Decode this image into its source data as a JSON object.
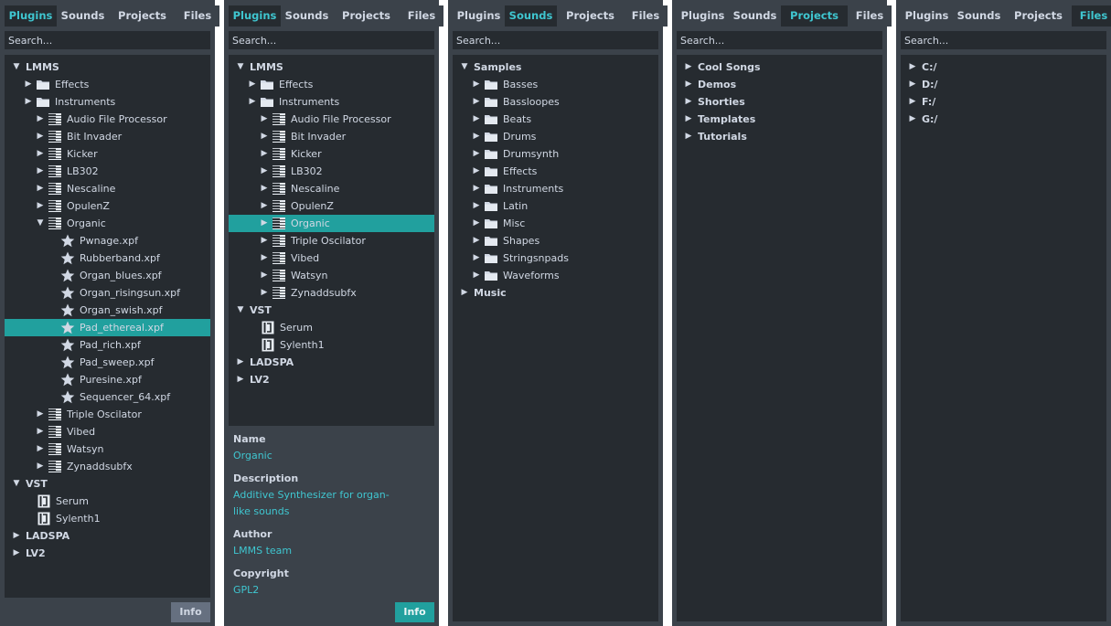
{
  "colors": {
    "panel_bg": "#3b424a",
    "tree_bg": "#262b30",
    "accent": "#3fc6d0",
    "selection": "#21a09e",
    "text": "#d1d8e4"
  },
  "tabs": [
    "Plugins",
    "Sounds",
    "Projects",
    "Files"
  ],
  "search_placeholder": "Search...",
  "info_label": "Info",
  "panels": [
    {
      "active_tab": "Plugins",
      "tree": [
        {
          "label": "LMMS",
          "level": 0,
          "arrow": "down",
          "icon": "none",
          "bold": true
        },
        {
          "label": "Effects",
          "level": 1,
          "arrow": "right",
          "icon": "folder-icon"
        },
        {
          "label": "Instruments",
          "level": 1,
          "arrow": "right",
          "icon": "folder-icon"
        },
        {
          "label": "Audio File Processor",
          "level": 2,
          "arrow": "right",
          "icon": "piano-icon"
        },
        {
          "label": "Bit Invader",
          "level": 2,
          "arrow": "right",
          "icon": "piano-icon"
        },
        {
          "label": "Kicker",
          "level": 2,
          "arrow": "right",
          "icon": "piano-icon"
        },
        {
          "label": "LB302",
          "level": 2,
          "arrow": "right",
          "icon": "piano-icon"
        },
        {
          "label": "Nescaline",
          "level": 2,
          "arrow": "right",
          "icon": "piano-icon"
        },
        {
          "label": "OpulenZ",
          "level": 2,
          "arrow": "right",
          "icon": "piano-icon"
        },
        {
          "label": "Organic",
          "level": 2,
          "arrow": "down",
          "icon": "piano-icon"
        },
        {
          "label": "Pwnage.xpf",
          "level": 3,
          "arrow": "none",
          "icon": "star-icon"
        },
        {
          "label": "Rubberband.xpf",
          "level": 3,
          "arrow": "none",
          "icon": "star-icon"
        },
        {
          "label": "Organ_blues.xpf",
          "level": 3,
          "arrow": "none",
          "icon": "star-icon"
        },
        {
          "label": "Organ_risingsun.xpf",
          "level": 3,
          "arrow": "none",
          "icon": "star-icon"
        },
        {
          "label": "Organ_swish.xpf",
          "level": 3,
          "arrow": "none",
          "icon": "star-icon"
        },
        {
          "label": "Pad_ethereal.xpf",
          "level": 3,
          "arrow": "none",
          "icon": "star-icon",
          "selected": true
        },
        {
          "label": "Pad_rich.xpf",
          "level": 3,
          "arrow": "none",
          "icon": "star-icon"
        },
        {
          "label": "Pad_sweep.xpf",
          "level": 3,
          "arrow": "none",
          "icon": "star-icon"
        },
        {
          "label": "Puresine.xpf",
          "level": 3,
          "arrow": "none",
          "icon": "star-icon"
        },
        {
          "label": "Sequencer_64.xpf",
          "level": 3,
          "arrow": "none",
          "icon": "star-icon"
        },
        {
          "label": "Triple Oscilator",
          "level": 2,
          "arrow": "right",
          "icon": "piano-icon"
        },
        {
          "label": "Vibed",
          "level": 2,
          "arrow": "right",
          "icon": "piano-icon"
        },
        {
          "label": "Watsyn",
          "level": 2,
          "arrow": "right",
          "icon": "piano-icon"
        },
        {
          "label": "Zynaddsubfx",
          "level": 2,
          "arrow": "right",
          "icon": "piano-icon"
        },
        {
          "label": "VST",
          "level": 0,
          "arrow": "down",
          "icon": "none",
          "bold": true
        },
        {
          "label": "Serum",
          "level": 1,
          "arrow": "none",
          "icon": "plugin-icon"
        },
        {
          "label": "Sylenth1",
          "level": 1,
          "arrow": "none",
          "icon": "plugin-icon"
        },
        {
          "label": "LADSPA",
          "level": 0,
          "arrow": "right",
          "icon": "none",
          "bold": true
        },
        {
          "label": "LV2",
          "level": 0,
          "arrow": "right",
          "icon": "none",
          "bold": true
        }
      ]
    },
    {
      "active_tab": "Plugins",
      "tree": [
        {
          "label": "LMMS",
          "level": 0,
          "arrow": "down",
          "icon": "none",
          "bold": true
        },
        {
          "label": "Effects",
          "level": 1,
          "arrow": "right",
          "icon": "folder-icon"
        },
        {
          "label": "Instruments",
          "level": 1,
          "arrow": "right",
          "icon": "folder-icon"
        },
        {
          "label": "Audio File Processor",
          "level": 2,
          "arrow": "right",
          "icon": "piano-icon"
        },
        {
          "label": "Bit Invader",
          "level": 2,
          "arrow": "right",
          "icon": "piano-icon"
        },
        {
          "label": "Kicker",
          "level": 2,
          "arrow": "right",
          "icon": "piano-icon"
        },
        {
          "label": "LB302",
          "level": 2,
          "arrow": "right",
          "icon": "piano-icon"
        },
        {
          "label": "Nescaline",
          "level": 2,
          "arrow": "right",
          "icon": "piano-icon"
        },
        {
          "label": "OpulenZ",
          "level": 2,
          "arrow": "right",
          "icon": "piano-icon"
        },
        {
          "label": "Organic",
          "level": 2,
          "arrow": "right",
          "icon": "piano-icon",
          "selected": true
        },
        {
          "label": "Triple Oscilator",
          "level": 2,
          "arrow": "right",
          "icon": "piano-icon"
        },
        {
          "label": "Vibed",
          "level": 2,
          "arrow": "right",
          "icon": "piano-icon"
        },
        {
          "label": "Watsyn",
          "level": 2,
          "arrow": "right",
          "icon": "piano-icon"
        },
        {
          "label": "Zynaddsubfx",
          "level": 2,
          "arrow": "right",
          "icon": "piano-icon"
        },
        {
          "label": "VST",
          "level": 0,
          "arrow": "down",
          "icon": "none",
          "bold": true
        },
        {
          "label": "Serum",
          "level": 1,
          "arrow": "none",
          "icon": "plugin-icon"
        },
        {
          "label": "Sylenth1",
          "level": 1,
          "arrow": "none",
          "icon": "plugin-icon"
        },
        {
          "label": "LADSPA",
          "level": 0,
          "arrow": "right",
          "icon": "none",
          "bold": true
        },
        {
          "label": "LV2",
          "level": 0,
          "arrow": "right",
          "icon": "none",
          "bold": true
        }
      ],
      "details": {
        "name_label": "Name",
        "name": "Organic",
        "description_label": "Description",
        "description": "Additive Synthesizer for organ-like sounds",
        "author_label": "Author",
        "author": "LMMS team",
        "copyright_label": "Copyright",
        "copyright": "GPL2"
      }
    },
    {
      "active_tab": "Sounds",
      "tree": [
        {
          "label": "Samples",
          "level": 0,
          "arrow": "down",
          "icon": "none",
          "bold": true
        },
        {
          "label": "Basses",
          "level": 1,
          "arrow": "right",
          "icon": "folder-icon"
        },
        {
          "label": "Bassloopes",
          "level": 1,
          "arrow": "right",
          "icon": "folder-icon"
        },
        {
          "label": "Beats",
          "level": 1,
          "arrow": "right",
          "icon": "folder-icon"
        },
        {
          "label": "Drums",
          "level": 1,
          "arrow": "right",
          "icon": "folder-icon"
        },
        {
          "label": "Drumsynth",
          "level": 1,
          "arrow": "right",
          "icon": "folder-icon"
        },
        {
          "label": "Effects",
          "level": 1,
          "arrow": "right",
          "icon": "folder-icon"
        },
        {
          "label": "Instruments",
          "level": 1,
          "arrow": "right",
          "icon": "folder-icon"
        },
        {
          "label": "Latin",
          "level": 1,
          "arrow": "right",
          "icon": "folder-icon"
        },
        {
          "label": "Misc",
          "level": 1,
          "arrow": "right",
          "icon": "folder-icon"
        },
        {
          "label": "Shapes",
          "level": 1,
          "arrow": "right",
          "icon": "folder-icon"
        },
        {
          "label": "Stringsnpads",
          "level": 1,
          "arrow": "right",
          "icon": "folder-icon"
        },
        {
          "label": "Waveforms",
          "level": 1,
          "arrow": "right",
          "icon": "folder-icon"
        },
        {
          "label": "Music",
          "level": 0,
          "arrow": "right",
          "icon": "none",
          "bold": true
        }
      ]
    },
    {
      "active_tab": "Projects",
      "tree": [
        {
          "label": "Cool Songs",
          "level": 0,
          "arrow": "right",
          "icon": "none",
          "bold": true
        },
        {
          "label": "Demos",
          "level": 0,
          "arrow": "right",
          "icon": "none",
          "bold": true
        },
        {
          "label": "Shorties",
          "level": 0,
          "arrow": "right",
          "icon": "none",
          "bold": true
        },
        {
          "label": "Templates",
          "level": 0,
          "arrow": "right",
          "icon": "none",
          "bold": true
        },
        {
          "label": "Tutorials",
          "level": 0,
          "arrow": "right",
          "icon": "none",
          "bold": true
        }
      ]
    },
    {
      "active_tab": "Files",
      "tree": [
        {
          "label": "C:/",
          "level": 0,
          "arrow": "right",
          "icon": "none",
          "bold": true
        },
        {
          "label": "D:/",
          "level": 0,
          "arrow": "right",
          "icon": "none",
          "bold": true
        },
        {
          "label": "F:/",
          "level": 0,
          "arrow": "right",
          "icon": "none",
          "bold": true
        },
        {
          "label": "G:/",
          "level": 0,
          "arrow": "right",
          "icon": "none",
          "bold": true
        }
      ]
    }
  ]
}
